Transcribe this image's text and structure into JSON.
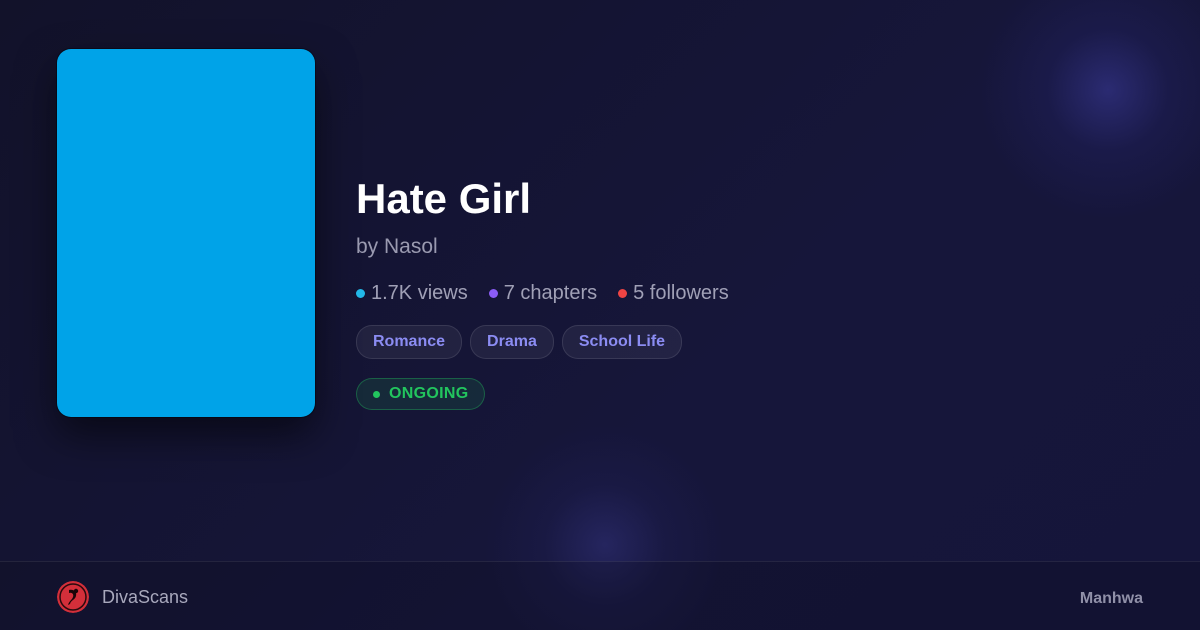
{
  "series": {
    "title": "Hate Girl",
    "author_line": "by Nasol",
    "cover_color": "#00a3e8"
  },
  "stats": [
    {
      "label": "1.7K views",
      "dot_color": "#22b8e8"
    },
    {
      "label": "7 chapters",
      "dot_color": "#8b5cf6"
    },
    {
      "label": "5 followers",
      "dot_color": "#ef4444"
    }
  ],
  "genres": [
    "Romance",
    "Drama",
    "School Life"
  ],
  "status": {
    "label": "ONGOING",
    "color": "#22c55e"
  },
  "footer": {
    "site_name": "DivaScans",
    "category": "Manhwa",
    "logo_color": "#d32f3a"
  }
}
